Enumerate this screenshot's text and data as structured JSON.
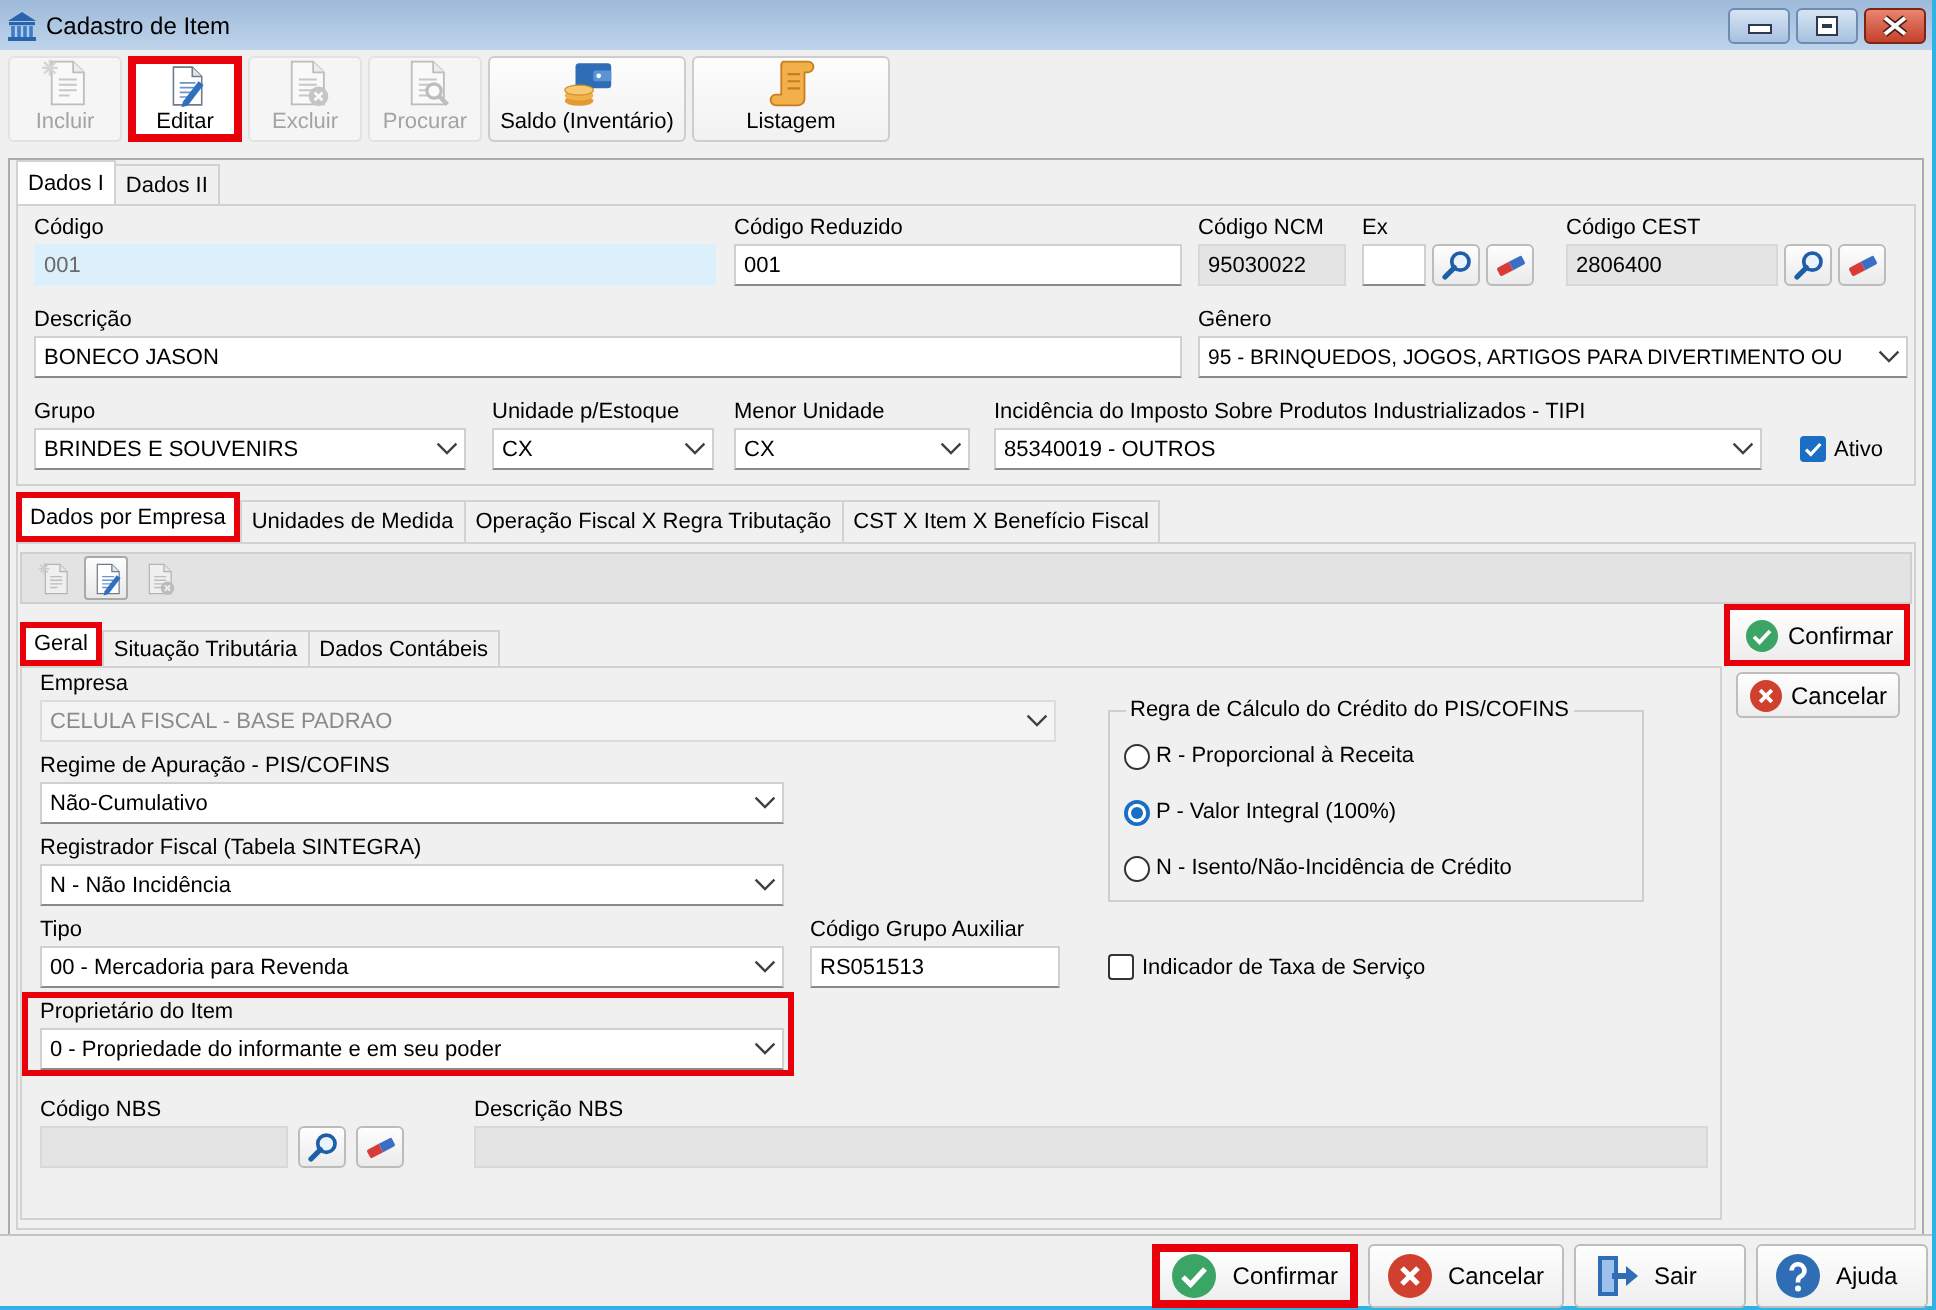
{
  "window": {
    "title": "Cadastro de Item"
  },
  "toolbar": [
    {
      "label": "Incluir",
      "kind": "new",
      "disabled": true,
      "highlighted": false
    },
    {
      "label": "Editar",
      "kind": "edit",
      "disabled": false,
      "highlighted": true
    },
    {
      "label": "Excluir",
      "kind": "delete",
      "disabled": true,
      "highlighted": false
    },
    {
      "label": "Procurar",
      "kind": "find",
      "disabled": true,
      "highlighted": false
    },
    {
      "label": "Saldo (Inventário)",
      "kind": "balance",
      "disabled": false,
      "highlighted": false
    },
    {
      "label": "Listagem",
      "kind": "list",
      "disabled": false,
      "highlighted": false
    }
  ],
  "main_tabs": [
    {
      "label": "Dados I",
      "selected": true
    },
    {
      "label": "Dados II",
      "selected": false
    }
  ],
  "form_rows": [
    [
      {
        "label": "Código",
        "kind": "key",
        "value": "001"
      },
      {
        "label": "Código Reduzido",
        "kind": "text",
        "value": "001"
      },
      {
        "label": "Código NCM",
        "kind": "readonly",
        "value": "95030022"
      },
      {
        "label": "Ex",
        "kind": "text",
        "lookup": true
      },
      {
        "label": "Código CEST",
        "kind": "readonly",
        "value": "2806400",
        "lookup": true
      }
    ],
    [
      {
        "label": "Descrição",
        "kind": "text",
        "value": "BONECO JASON"
      },
      {
        "label": "Gênero",
        "kind": "select",
        "value": "95 - BRINQUEDOS, JOGOS, ARTIGOS PARA DIVERTIMENTO OU"
      }
    ],
    [
      {
        "label": "Grupo",
        "kind": "select",
        "value": "BRINDES E SOUVENIRS"
      },
      {
        "label": "Unidade p/Estoque",
        "kind": "select",
        "value": "CX"
      },
      {
        "label": "Menor Unidade",
        "kind": "select",
        "value": "CX"
      },
      {
        "label": "Incidência do Imposto Sobre Produtos Industrializados - TIPI",
        "kind": "select",
        "value": "85340019 - OUTROS"
      },
      {
        "label": "Ativo",
        "kind": "checkbox",
        "checked": true
      }
    ]
  ],
  "detail_tabs": [
    {
      "label": "Dados por Empresa",
      "selected": true,
      "highlighted": true
    },
    {
      "label": "Unidades de Medida",
      "selected": false,
      "highlighted": false
    },
    {
      "label": "Operação Fiscal X Regra Tributação",
      "selected": false,
      "highlighted": false
    },
    {
      "label": "CST X Item X Benefício Fiscal",
      "selected": false,
      "highlighted": false
    }
  ],
  "detail_toolbar": [
    {
      "kind": "new",
      "disabled": true
    },
    {
      "kind": "edit",
      "disabled": false
    },
    {
      "kind": "delete",
      "disabled": true
    }
  ],
  "sub_tabs": [
    {
      "label": "Geral",
      "selected": true,
      "highlighted": true
    },
    {
      "label": "Situação Tributária",
      "selected": false,
      "highlighted": false
    },
    {
      "label": "Dados Contábeis",
      "selected": false,
      "highlighted": false
    }
  ],
  "geral": {
    "fields": [
      {
        "label": "Empresa",
        "kind": "select",
        "value": "CELULA FISCAL - BASE PADRAO",
        "disabled": true,
        "highlighted": false
      },
      {
        "label": "Regime de Apuração - PIS/COFINS",
        "kind": "select",
        "value": "Não-Cumulativo",
        "disabled": false,
        "highlighted": false
      },
      {
        "label": "Registrador Fiscal (Tabela SINTEGRA)",
        "kind": "select",
        "value": "N - Não Incidência",
        "disabled": false,
        "highlighted": false
      },
      {
        "label": "Tipo",
        "kind": "select",
        "value": "00 - Mercadoria para Revenda",
        "disabled": false,
        "highlighted": false
      },
      {
        "label": "Código Grupo Auxiliar",
        "kind": "text",
        "value": "RS051513",
        "disabled": false,
        "highlighted": false
      },
      {
        "label": "Proprietário do Item",
        "kind": "select",
        "value": "0 - Propriedade do informante e em seu poder",
        "disabled": false,
        "highlighted": true
      },
      {
        "label": "Código NBS",
        "kind": "readonly",
        "lookup": true,
        "disabled": false,
        "highlighted": false
      },
      {
        "label": "Descrição NBS",
        "kind": "readonly",
        "disabled": false,
        "highlighted": false
      }
    ],
    "credit_rule": {
      "title": "Regra de Cálculo do Crédito do PIS/COFINS",
      "options": [
        {
          "label": "R - Proporcional à Receita",
          "selected": false
        },
        {
          "label": "P - Valor Integral (100%)",
          "selected": true
        },
        {
          "label": "N - Isento/Não-Incidência de Crédito",
          "selected": false
        }
      ]
    },
    "service_fee": {
      "label": "Indicador de Taxa de Serviço",
      "checked": false
    }
  },
  "side_actions": [
    {
      "label": "Confirmar",
      "kind": "confirm",
      "highlighted": true
    },
    {
      "label": "Cancelar",
      "kind": "cancel",
      "highlighted": false
    }
  ],
  "footer_actions": [
    {
      "label": "Confirmar",
      "kind": "confirm",
      "highlighted": true
    },
    {
      "label": "Cancelar",
      "kind": "cancel",
      "highlighted": false
    },
    {
      "label": "Sair",
      "kind": "exit",
      "highlighted": false
    },
    {
      "label": "Ajuda",
      "kind": "help",
      "highlighted": false
    }
  ]
}
